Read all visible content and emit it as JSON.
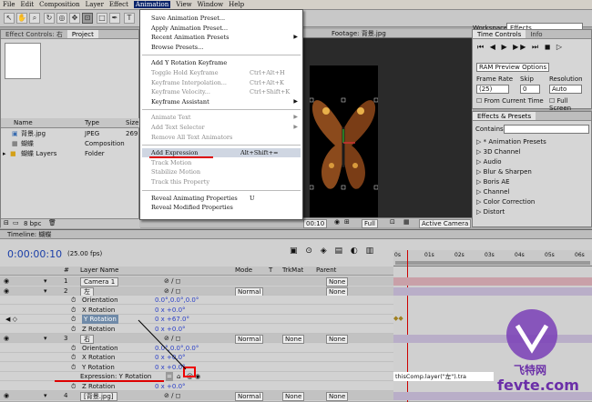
{
  "menubar": [
    "File",
    "Edit",
    "Composition",
    "Layer",
    "Effect",
    "Animation",
    "View",
    "Window",
    "Help"
  ],
  "workspace": {
    "label": "Workspace:",
    "value": "Effects"
  },
  "project": {
    "tabs": [
      "Effect Controls: 右",
      "Project"
    ],
    "columns": [
      "Name",
      "Type",
      "Size"
    ],
    "items": [
      {
        "name": "背景.jpg",
        "type": "JPEG",
        "size": "269"
      },
      {
        "name": "蝴蝶",
        "type": "Composition",
        "size": ""
      },
      {
        "name": "蝴蝶 Layers",
        "type": "Folder",
        "size": ""
      }
    ],
    "bpc": "8 bpc"
  },
  "viewer": {
    "tab": "Footage: 背景.jpg",
    "time": "00:10",
    "quality": "Full",
    "camera": "Active Camera"
  },
  "animation_menu": {
    "items": [
      {
        "label": "Save Animation Preset...",
        "shortcut": "",
        "enabled": true,
        "submenu": false
      },
      {
        "label": "Apply Animation Preset...",
        "shortcut": "",
        "enabled": true,
        "submenu": false
      },
      {
        "label": "Recent Animation Presets",
        "shortcut": "",
        "enabled": true,
        "submenu": true
      },
      {
        "label": "Browse Presets...",
        "shortcut": "",
        "enabled": true,
        "submenu": false
      },
      {
        "sep": true
      },
      {
        "label": "Add Y Rotation Keyframe",
        "shortcut": "",
        "enabled": true,
        "submenu": false
      },
      {
        "label": "Toggle Hold Keyframe",
        "shortcut": "Ctrl+Alt+H",
        "enabled": false,
        "submenu": false
      },
      {
        "label": "Keyframe Interpolation...",
        "shortcut": "Ctrl+Alt+K",
        "enabled": false,
        "submenu": false
      },
      {
        "label": "Keyframe Velocity...",
        "shortcut": "Ctrl+Shift+K",
        "enabled": false,
        "submenu": false
      },
      {
        "label": "Keyframe Assistant",
        "shortcut": "",
        "enabled": true,
        "submenu": true
      },
      {
        "sep": true
      },
      {
        "label": "Animate Text",
        "shortcut": "",
        "enabled": false,
        "submenu": true
      },
      {
        "label": "Add Text Selector",
        "shortcut": "",
        "enabled": false,
        "submenu": true
      },
      {
        "label": "Remove All Text Animators",
        "shortcut": "",
        "enabled": false,
        "submenu": false
      },
      {
        "sep": true
      },
      {
        "label": "Add Expression",
        "shortcut": "Alt+Shift+=",
        "enabled": true,
        "submenu": false,
        "highlight": true
      },
      {
        "label": "Track Motion",
        "shortcut": "",
        "enabled": false,
        "submenu": false
      },
      {
        "label": "Stabilize Motion",
        "shortcut": "",
        "enabled": false,
        "submenu": false
      },
      {
        "label": "Track this Property",
        "shortcut": "",
        "enabled": false,
        "submenu": false
      },
      {
        "sep": true
      },
      {
        "label": "Reveal Animating Properties",
        "shortcut": "U",
        "enabled": true,
        "submenu": false
      },
      {
        "label": "Reveal Modified Properties",
        "shortcut": "",
        "enabled": true,
        "submenu": false
      }
    ]
  },
  "time_controls": {
    "tabs": [
      "Time Controls",
      "Info"
    ],
    "ram": "RAM Preview Options",
    "labels": [
      "Frame Rate",
      "Skip",
      "Resolution"
    ],
    "values": [
      "(25)",
      "0",
      "Auto"
    ],
    "checks": [
      "From Current Time",
      "Full Screen"
    ]
  },
  "effects": {
    "tabs": [
      "Effects & Presets"
    ],
    "contains": "Contains:",
    "items": [
      "* Animation Presets",
      "3D Channel",
      "Audio",
      "Blur & Sharpen",
      "Boris AE",
      "Channel",
      "Color Correction",
      "Distort"
    ]
  },
  "timeline": {
    "tab": "Timeline: 蝴蝶",
    "timecode": "0:00:00:10",
    "fps": "(25.00 fps)",
    "headers": [
      "#",
      "Layer Name",
      "Mode",
      "T",
      "TrkMat",
      "Parent"
    ],
    "ruler": [
      "0s",
      "01s",
      "02s",
      "03s",
      "04s",
      "05s",
      "06s"
    ],
    "rows": [
      {
        "kind": "layer",
        "num": "1",
        "name": "Camera 1",
        "mode": "",
        "parent": "None"
      },
      {
        "kind": "layer",
        "num": "2",
        "name": "左",
        "mode": "Normal",
        "trkmat": "",
        "parent": "None"
      },
      {
        "kind": "prop",
        "name": "Orientation",
        "value": "0.0°,0.0°,0.0°"
      },
      {
        "kind": "prop",
        "name": "X Rotation",
        "value": "0 x +0.0°"
      },
      {
        "kind": "prop",
        "name": "Y Rotation",
        "value": "0 x +67.0°",
        "selected": true
      },
      {
        "kind": "prop",
        "name": "Z Rotation",
        "value": "0 x +0.0°"
      },
      {
        "kind": "layer",
        "num": "3",
        "name": "右",
        "mode": "Normal",
        "trkmat": "None",
        "parent": "None"
      },
      {
        "kind": "prop",
        "name": "Orientation",
        "value": "0.0°,0.0°,0.0°"
      },
      {
        "kind": "prop",
        "name": "X Rotation",
        "value": "0 x +0.0°"
      },
      {
        "kind": "prop",
        "name": "Y Rotation",
        "value": "0 x +0.0°"
      },
      {
        "kind": "prop",
        "name": "Expression: Y Rotation",
        "value": "",
        "expr": true
      },
      {
        "kind": "prop",
        "name": "Z Rotation",
        "value": "0 x +0.0°"
      },
      {
        "kind": "layer",
        "num": "4",
        "name": "[背景.jpg]",
        "mode": "Normal",
        "trkmat": "None",
        "parent": "None"
      }
    ],
    "expression_text": "thisComp.layer(\"左\").tra"
  },
  "watermark": {
    "brand": "飞特网",
    "url": "fevte.com"
  }
}
